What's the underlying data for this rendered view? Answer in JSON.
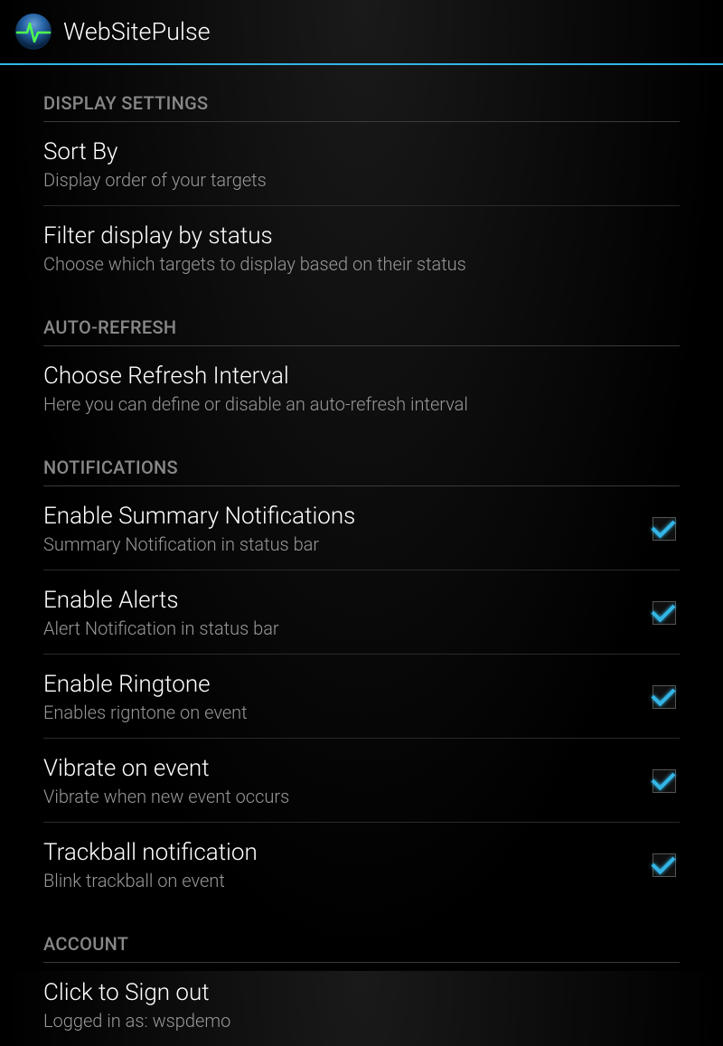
{
  "header": {
    "title": "WebSitePulse"
  },
  "sections": {
    "display": {
      "header": "DISPLAY SETTINGS",
      "sortBy": {
        "title": "Sort By",
        "subtitle": "Display order of your targets"
      },
      "filter": {
        "title": "Filter display by status",
        "subtitle": "Choose which targets to display based on their status"
      }
    },
    "autoRefresh": {
      "header": "AUTO-REFRESH",
      "interval": {
        "title": "Choose Refresh Interval",
        "subtitle": "Here you can define or disable an auto-refresh interval"
      }
    },
    "notifications": {
      "header": "NOTIFICATIONS",
      "summary": {
        "title": "Enable Summary Notifications",
        "subtitle": "Summary Notification in status bar",
        "checked": true
      },
      "alerts": {
        "title": "Enable Alerts",
        "subtitle": "Alert Notification in status bar",
        "checked": true
      },
      "ringtone": {
        "title": "Enable Ringtone",
        "subtitle": "Enables rigntone on event",
        "checked": true
      },
      "vibrate": {
        "title": "Vibrate on event",
        "subtitle": "Vibrate when new event occurs",
        "checked": true
      },
      "trackball": {
        "title": "Trackball notification",
        "subtitle": "Blink trackball on event",
        "checked": true
      }
    },
    "account": {
      "header": "ACCOUNT",
      "signout": {
        "title": "Click to Sign out",
        "subtitle": "Logged in as: wspdemo"
      }
    }
  }
}
